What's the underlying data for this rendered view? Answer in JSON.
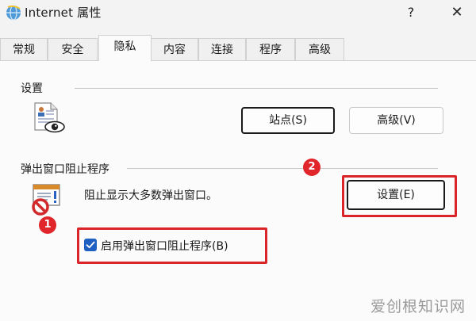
{
  "window": {
    "title": "Internet 属性",
    "help": "?",
    "close": "✕"
  },
  "tabs": [
    {
      "label": "常规"
    },
    {
      "label": "安全"
    },
    {
      "label": "隐私",
      "active": true
    },
    {
      "label": "内容"
    },
    {
      "label": "连接"
    },
    {
      "label": "程序"
    },
    {
      "label": "高级"
    }
  ],
  "settings_group": {
    "title": "设置",
    "icon": "privacy-document-eye-icon",
    "sites_button": "站点(S)",
    "advanced_button": "高级(V)"
  },
  "popup_group": {
    "title": "弹出窗口阻止程序",
    "icon": "popup-blocked-icon",
    "description": "阻止显示大多数弹出窗口。",
    "settings_button": "设置(E)",
    "checkbox_label": "启用弹出窗口阻止程序(B)",
    "checkbox_checked": true
  },
  "annotations": {
    "badge_1": "1",
    "badge_2": "2",
    "highlight_color": "#d9252a"
  },
  "watermark": "爱创根知识网",
  "colors": {
    "accent": "#1e5fc2",
    "annotation_red": "#e0262b"
  }
}
